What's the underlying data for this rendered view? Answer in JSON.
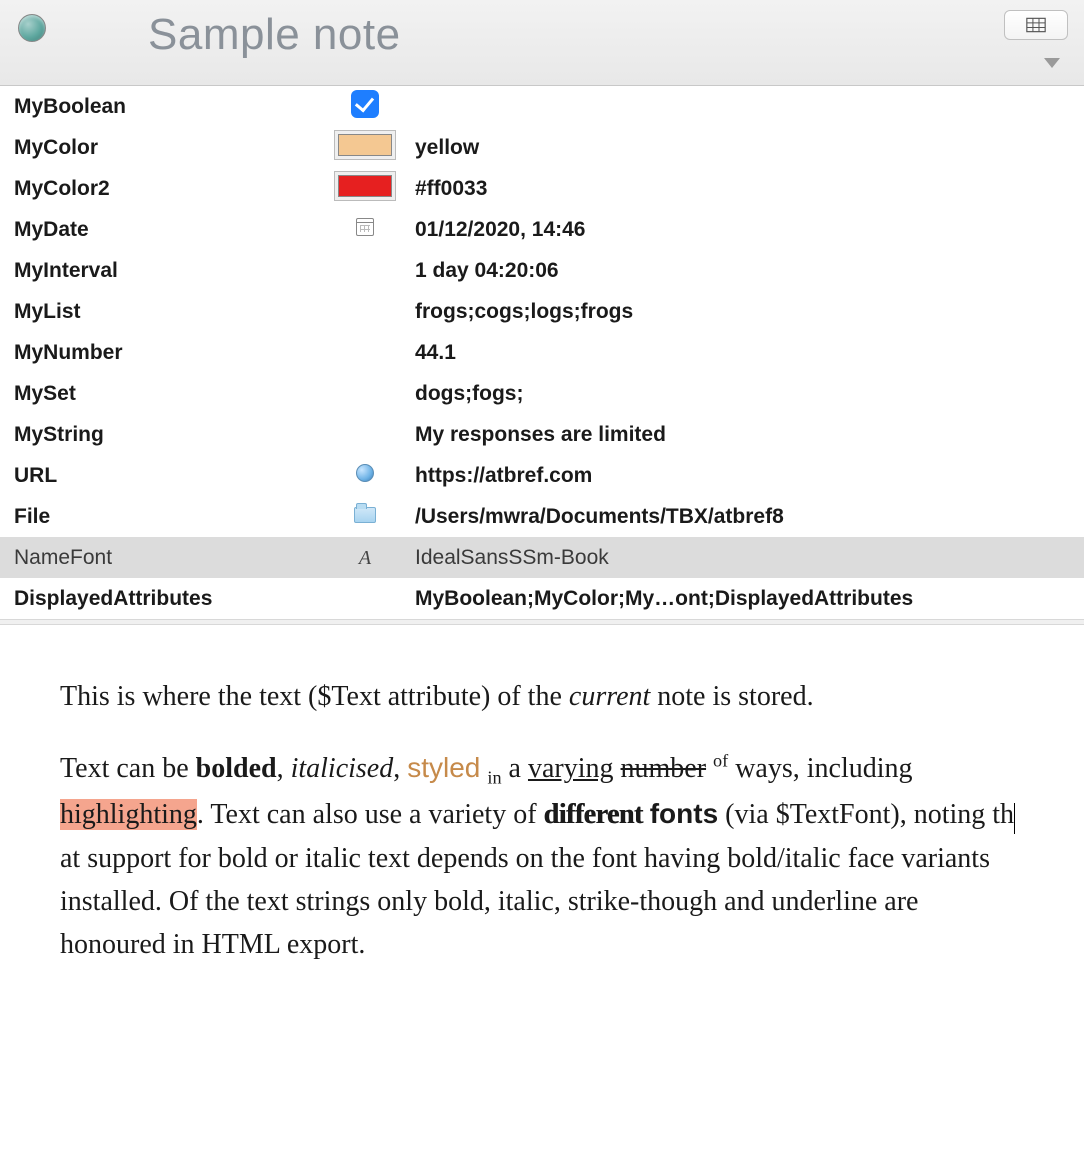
{
  "header": {
    "title": "Sample note"
  },
  "attributes": [
    {
      "name": "MyBoolean",
      "value": "",
      "kind": "checkbox",
      "checked": true
    },
    {
      "name": "MyColor",
      "value": "yellow",
      "kind": "color",
      "swatch": "#f4c892"
    },
    {
      "name": "MyColor2",
      "value": "#ff0033",
      "kind": "color",
      "swatch": "#e62020"
    },
    {
      "name": "MyDate",
      "value": "01/12/2020, 14:46",
      "kind": "date"
    },
    {
      "name": "MyInterval",
      "value": "1 day 04:20:06",
      "kind": "plain"
    },
    {
      "name": "MyList",
      "value": "frogs;cogs;logs;frogs",
      "kind": "plain"
    },
    {
      "name": "MyNumber",
      "value": "44.1",
      "kind": "plain"
    },
    {
      "name": "MySet",
      "value": "dogs;fogs;",
      "kind": "plain"
    },
    {
      "name": "MyString",
      "value": "My responses are limited",
      "kind": "plain"
    },
    {
      "name": "URL",
      "value": "https://atbref.com",
      "kind": "url"
    },
    {
      "name": "File",
      "value": "/Users/mwra/Documents/TBX/atbref8",
      "kind": "file"
    },
    {
      "name": "NameFont",
      "value": "IdealSansSSm-Book",
      "kind": "font",
      "selected": true
    },
    {
      "name": "DisplayedAttributes",
      "value": "MyBoolean;MyColor;My…ont;DisplayedAttributes",
      "kind": "plain"
    }
  ],
  "body": {
    "p1_a": "This is where the text ($Text attribute) of the ",
    "p1_current": "current",
    "p1_b": " note is stored.",
    "p2_a": "Text can be ",
    "p2_bold": "bolded",
    "p2_b": ", ",
    "p2_italic": "italicised",
    "p2_c": ", ",
    "p2_styled": "styled",
    "p2_d": " ",
    "p2_sub": "in",
    "p2_e": " a ",
    "p2_under": "varying",
    "p2_f": " ",
    "p2_strike": "number",
    "p2_g": " ",
    "p2_super": "of",
    "p2_h": " ways, including ",
    "p2_hilite": "highlighting",
    "p2_i": ". Text can also use a variety of ",
    "p2_font1": "different",
    "p2_j": " ",
    "p2_font2": "fonts",
    "p2_k": " (via $TextFont), noting th",
    "p2_l": "at support for bold or italic text depends on the font having bold/italic face variants installed. Of the text strings only bold, italic, strike-though and underline are honoured in HTML export."
  }
}
